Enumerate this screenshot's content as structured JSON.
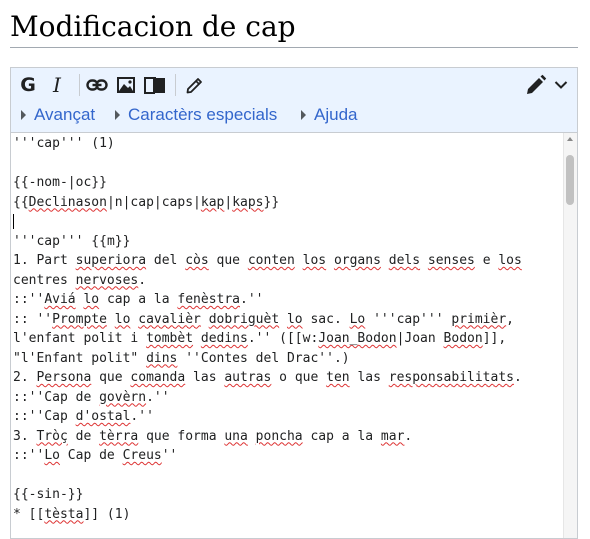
{
  "page": {
    "title": "Modificacion de cap"
  },
  "toolbar": {
    "bold_label": "G",
    "italic_label": "I",
    "icons": [
      "link-icon",
      "image-icon",
      "reference-icon",
      "signature-icon",
      "edit-mode-icon",
      "chevron-down-icon"
    ],
    "tabs": [
      {
        "label": "Avançat"
      },
      {
        "label": "Caractèrs especials"
      },
      {
        "label": "Ajuda"
      }
    ]
  },
  "content": {
    "lines": [
      "'''cap''' (1)",
      "",
      "{{-nom-|oc}}",
      "{{Declinason|n|cap|caps|kap|kaps}}",
      "",
      "'''cap''' {{m}}",
      "1. Part superiora del còs que conten los organs dels senses e los",
      "centres nervoses.",
      "::''Aviá lo cap a la fenèstra.''",
      ":: ''Prompte lo cavalièr dobriguèt lo sac. Lo '''cap''' primièr,",
      "l'enfant polit i tombèt dedins.'' ([[w:Joan_Bodon|Joan Bodon]],",
      "\"l'Enfant polit\" dins ''Contes del Drac''.)",
      "2. Persona que comanda las autras o que ten las responsabilitats.",
      "::''Cap de govèrn.''",
      "::''Cap d'ostal.''",
      "3. Tròç de tèrra que forma una poncha cap a la mar.",
      "::''Lo Cap de Creus''",
      "",
      "{{-sin-}}",
      "* [[tèsta]] (1)",
      ""
    ]
  },
  "colors": {
    "toolbar_bg": "#eaf3ff",
    "link": "#3366cc",
    "spellcheck": "#dd3333"
  }
}
